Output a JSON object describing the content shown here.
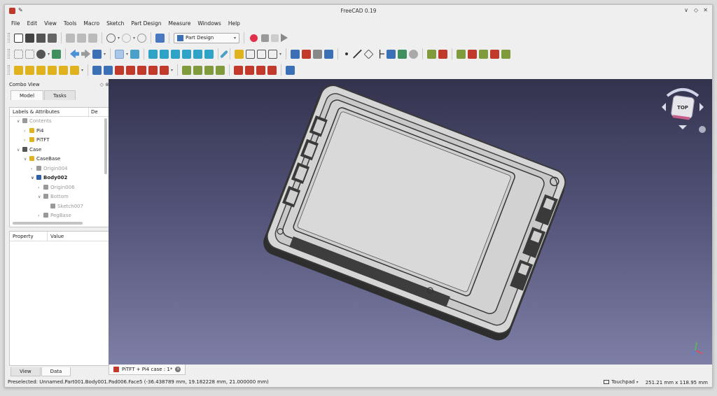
{
  "window": {
    "title": "FreeCAD 0.19",
    "controls": [
      "∨",
      "◇",
      "✕"
    ]
  },
  "menu": [
    "File",
    "Edit",
    "View",
    "Tools",
    "Macro",
    "Sketch",
    "Part Design",
    "Measure",
    "Windows",
    "Help"
  ],
  "toolbar": {
    "workbench_value": "Part Design"
  },
  "combo_view": {
    "title": "Combo View",
    "tabs": [
      "Model",
      "Tasks"
    ],
    "tree_headers": [
      "Labels & Attributes",
      "De"
    ],
    "tree": [
      {
        "label": "Contents",
        "indent": 1,
        "expand": "∨",
        "icon": "folder-icon",
        "color": "#9a9a9a",
        "dim": true,
        "bold": false
      },
      {
        "label": "Pi4",
        "indent": 2,
        "expand": "›",
        "icon": "part-icon",
        "color": "#e0b31e",
        "dim": false,
        "bold": false
      },
      {
        "label": "PiTFT",
        "indent": 2,
        "expand": "›",
        "icon": "part-icon",
        "color": "#e0b31e",
        "dim": false,
        "bold": false
      },
      {
        "label": "Case",
        "indent": 1,
        "expand": "∨",
        "icon": "folder-icon",
        "color": "#555555",
        "dim": false,
        "bold": false
      },
      {
        "label": "CaseBase",
        "indent": 2,
        "expand": "∨",
        "icon": "part-icon",
        "color": "#e0b31e",
        "dim": false,
        "bold": false
      },
      {
        "label": "Origin004",
        "indent": 3,
        "expand": "›",
        "icon": "origin-icon",
        "color": "#9a9a9a",
        "dim": true,
        "bold": false
      },
      {
        "label": "Body002",
        "indent": 3,
        "expand": "∨",
        "icon": "body-icon",
        "color": "#2c5fa8",
        "dim": false,
        "bold": true
      },
      {
        "label": "Origin006",
        "indent": 4,
        "expand": "›",
        "icon": "origin-icon",
        "color": "#9a9a9a",
        "dim": true,
        "bold": false
      },
      {
        "label": "Bottom",
        "indent": 4,
        "expand": "∨",
        "icon": "pad-icon",
        "color": "#9a9a9a",
        "dim": true,
        "bold": false
      },
      {
        "label": "Sketch007",
        "indent": 5,
        "expand": "",
        "icon": "sketch-icon",
        "color": "#9a9a9a",
        "dim": true,
        "bold": false
      },
      {
        "label": "PegBase",
        "indent": 4,
        "expand": "›",
        "icon": "pad-icon",
        "color": "#9a9a9a",
        "dim": true,
        "bold": false
      }
    ],
    "prop_headers": [
      "Property",
      "Value"
    ],
    "bottom_tabs": [
      "View",
      "Data"
    ]
  },
  "document_tab": "PiTFT + Pi4 case : 1*",
  "navcube": {
    "face_label": "TOP"
  },
  "status": {
    "preselected": "Preselected: Unnamed.Part001.Body001.Pad006.Face5 (-36.438789 mm, 19.182228 mm, 21.000000 mm)",
    "nav_style": "Touchpad",
    "dimensions": "251.21 mm x 118.95 mm"
  },
  "colors": {
    "viewport_top": "#33334e",
    "viewport_bottom": "#7e7fa6",
    "model_face": "#cfcfcf",
    "model_dark": "#3a3a3a",
    "record": "#e0304a"
  }
}
